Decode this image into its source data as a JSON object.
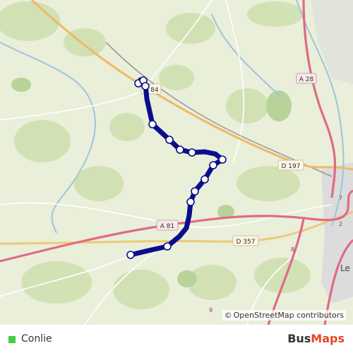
{
  "map": {
    "road_labels": [
      "A 28",
      "A 81",
      "D 197",
      "D 357",
      "84"
    ],
    "place_labels": [
      "Le"
    ],
    "small_labels": [
      "8",
      "9",
      "2",
      "7"
    ]
  },
  "route": {
    "color": "#0a0d8c",
    "stop_fill": "#ffffff",
    "stop_count": 14
  },
  "attribution": {
    "symbol": "©",
    "text": "OpenStreetMap contributors"
  },
  "footer": {
    "legend_label": "Conlie",
    "legend_color": "#44cc44",
    "brand_part1": "Bus",
    "brand_part2": "Maps",
    "brand_color1": "#333333",
    "brand_color2": "#e8442a"
  }
}
